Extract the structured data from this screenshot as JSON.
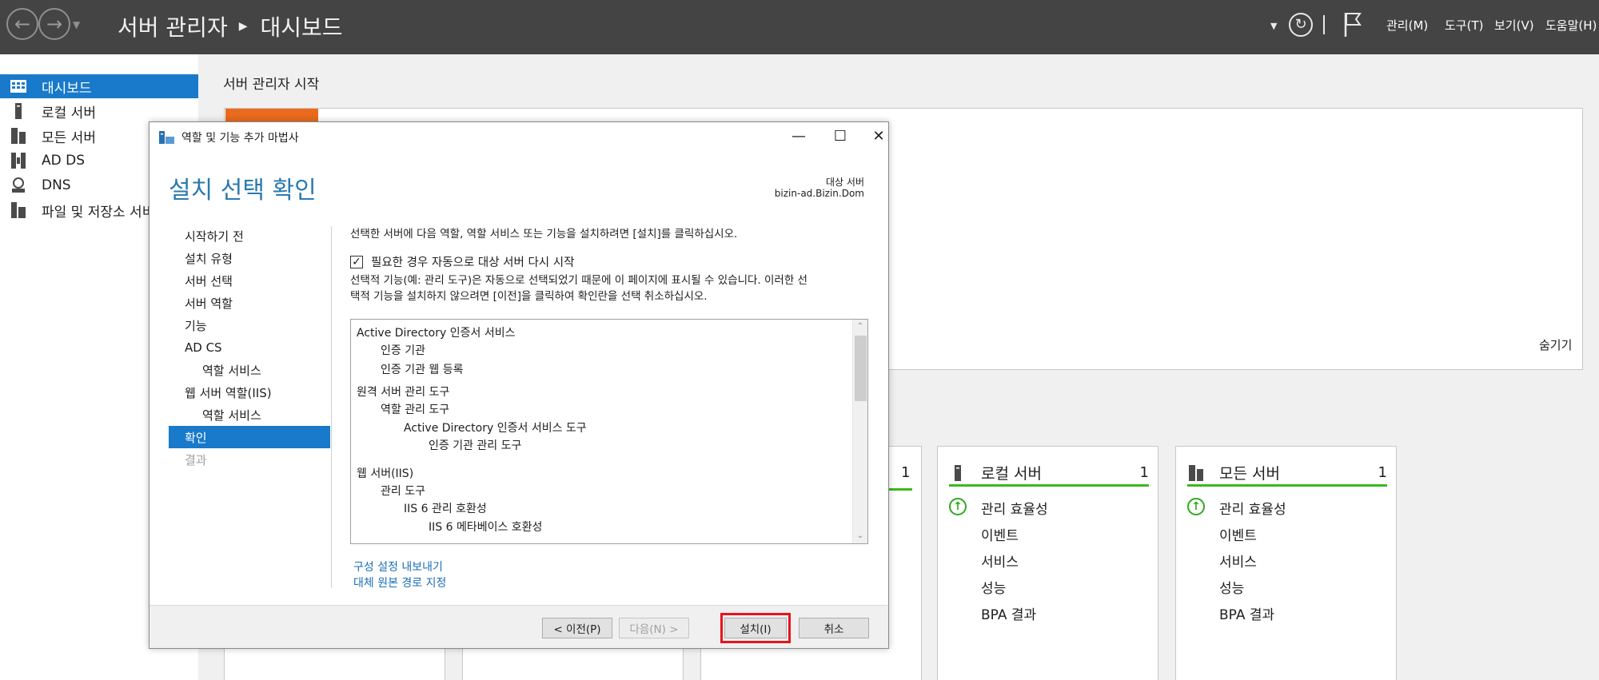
{
  "topbar": {
    "breadcrumb": [
      "서버 관리자",
      "대시보드"
    ],
    "menus": [
      "관리(M)",
      "도구(T)",
      "보기(V)",
      "도움말(H)"
    ]
  },
  "sidebar": {
    "items": [
      {
        "label": "대시보드",
        "icon": "dashboard-icon",
        "active": true
      },
      {
        "label": "로컬 서버",
        "icon": "server-icon"
      },
      {
        "label": "모든 서버",
        "icon": "servers-icon"
      },
      {
        "label": "AD DS",
        "icon": "ad-ds-icon"
      },
      {
        "label": "DNS",
        "icon": "dns-icon"
      },
      {
        "label": "파일 및 저장소 서비",
        "icon": "file-storage-icon"
      }
    ]
  },
  "main": {
    "welcome_title": "서버 관리자 시작",
    "hide_label": "숨기기",
    "tiles": [
      {
        "title": "로컬 서버",
        "count": "1",
        "rows": [
          "관리 효율성",
          "이벤트",
          "서비스",
          "성능",
          "BPA 결과"
        ]
      },
      {
        "title": "모든 서버",
        "count": "1",
        "rows": [
          "관리 효율성",
          "이벤트",
          "서비스",
          "성능",
          "BPA 결과"
        ]
      }
    ],
    "partial_tile_count": "1"
  },
  "dialog": {
    "title": "역할 및 기능 추가 마법사",
    "heading": "설치 선택 확인",
    "target_label": "대상 서버",
    "target_value": "bizin-ad.Bizin.Dom",
    "steps": [
      {
        "label": "시작하기 전"
      },
      {
        "label": "설치 유형"
      },
      {
        "label": "서버 선택"
      },
      {
        "label": "서버 역할"
      },
      {
        "label": "기능"
      },
      {
        "label": "AD CS"
      },
      {
        "label": "역할 서비스"
      },
      {
        "label": "웹 서버 역할(IIS)"
      },
      {
        "label": "역할 서비스"
      },
      {
        "label": "확인"
      },
      {
        "label": "결과"
      }
    ],
    "intro": "선택한 서버에 다음 역할, 역할 서비스 또는 기능을 설치하려면 [설치]를 클릭하십시오.",
    "restart_checkbox": {
      "label": "필요한 경우 자동으로 대상 서버 다시 시작",
      "checked": true
    },
    "note_line1": "선택적 기능(예: 관리 도구)은 자동으로 선택되었기 때문에 이 페이지에 표시될 수 있습니다. 이러한 선",
    "note_line2": "택적 기능을 설치하지 않으려면 [이전]을 클릭하여 확인란을 선택 취소하십시오.",
    "features": [
      "Active Directory 인증서 서비스",
      "인증 기관",
      "인증 기관 웹 등록",
      "원격 서버 관리 도구",
      "역할 관리 도구",
      "Active Directory 인증서 서비스 도구",
      "인증 기관 관리 도구",
      "웹 서버(IIS)",
      "관리 도구",
      "IIS 6 관리 호환성",
      "IIS 6 메타베이스 호환성"
    ],
    "links": {
      "export": "구성 설정 내보내기",
      "alt_source": "대체 원본 경로 지정"
    },
    "buttons": {
      "prev": "< 이전(P)",
      "next": "다음(N) >",
      "install": "설치(I)",
      "cancel": "취소"
    }
  }
}
